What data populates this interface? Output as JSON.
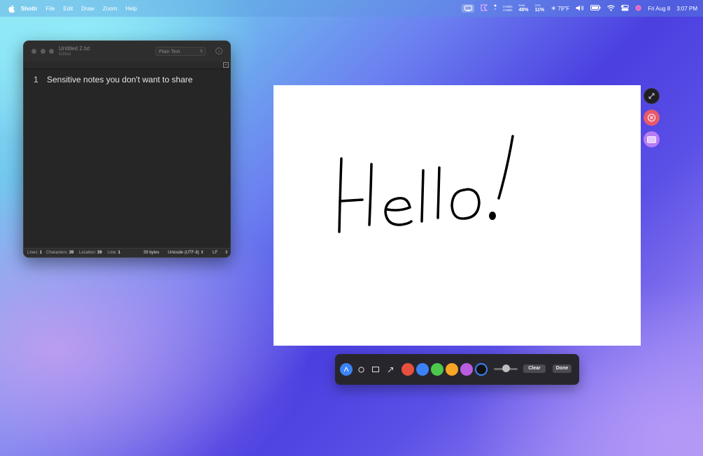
{
  "menubar": {
    "app_name": "Shottr",
    "menus": [
      "File",
      "Edit",
      "Draw",
      "Zoom",
      "Help"
    ],
    "net_up": "0 KB/s",
    "net_down": "2 KB/s",
    "ram_label": "RAM",
    "ram_value": "48%",
    "cpu_label": "CPU",
    "cpu_value": "11%",
    "weather": "79°F",
    "date": "Fri Aug 8",
    "time": "3:07 PM"
  },
  "editor": {
    "title": "Untitled 2.txt",
    "subtitle": "Edited",
    "format": "Plain Text",
    "line_number": "1",
    "line_text": "Sensitive notes you don't want to share",
    "status": {
      "lines_label": "Lines:",
      "lines_value": "1",
      "chars_label": "Characters:",
      "chars_value": "39",
      "location_label": "Location:",
      "location_value": "39",
      "line_label": "Line:",
      "line_value": "1",
      "bytes": "39 bytes",
      "encoding": "Unicode (UTF-8)",
      "line_ending": "LF"
    }
  },
  "toolbar": {
    "tools": [
      "pen-icon",
      "circle-icon",
      "rectangle-icon",
      "arrow-icon"
    ],
    "colors": [
      "#e8503e",
      "#3b82f6",
      "#4cc94c",
      "#f5a623",
      "#b95de0",
      "#111111"
    ],
    "selected_color": "#111111",
    "clear_label": "Clear",
    "done_label": "Done"
  }
}
